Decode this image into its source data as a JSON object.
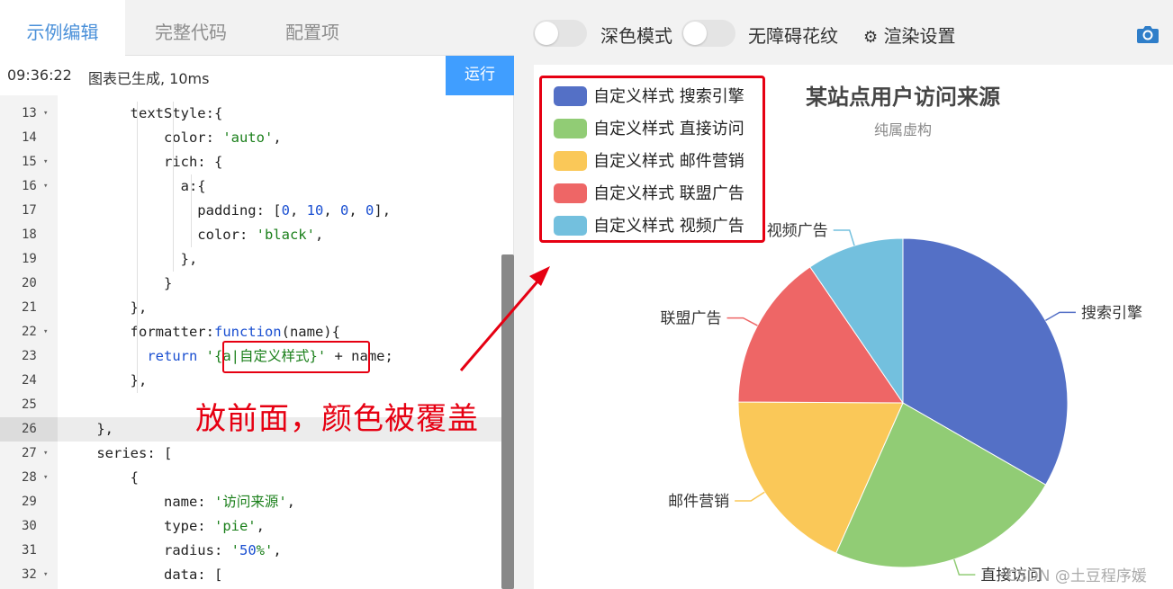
{
  "tabs": [
    "示例编辑",
    "完整代码",
    "配置项"
  ],
  "status": {
    "time": "09:36:22",
    "message": "图表已生成, 10ms"
  },
  "run_label": "运行",
  "code_lines": [
    {
      "n": "13",
      "fold": true,
      "text": "        textStyle:{"
    },
    {
      "n": "14",
      "fold": false,
      "text": "            color: 'auto',"
    },
    {
      "n": "15",
      "fold": true,
      "text": "            rich: {"
    },
    {
      "n": "16",
      "fold": true,
      "text": "              a:{"
    },
    {
      "n": "17",
      "fold": false,
      "text": "                padding: [0, 10, 0, 0],"
    },
    {
      "n": "18",
      "fold": false,
      "text": "                color: 'black',"
    },
    {
      "n": "19",
      "fold": false,
      "text": "              },"
    },
    {
      "n": "20",
      "fold": false,
      "text": "            }"
    },
    {
      "n": "21",
      "fold": false,
      "text": "        },"
    },
    {
      "n": "22",
      "fold": true,
      "text": "        formatter:function(name){"
    },
    {
      "n": "23",
      "fold": false,
      "text": "          return '{a|自定义样式}' + name;"
    },
    {
      "n": "24",
      "fold": false,
      "text": "        },"
    },
    {
      "n": "25",
      "fold": false,
      "text": ""
    },
    {
      "n": "26",
      "fold": false,
      "text": "    },"
    },
    {
      "n": "27",
      "fold": true,
      "text": "    series: ["
    },
    {
      "n": "28",
      "fold": true,
      "text": "        {"
    },
    {
      "n": "29",
      "fold": false,
      "text": "            name: '访问来源',"
    },
    {
      "n": "30",
      "fold": false,
      "text": "            type: 'pie',"
    },
    {
      "n": "31",
      "fold": false,
      "text": "            radius: '50%',"
    },
    {
      "n": "32",
      "fold": true,
      "text": "            data: ["
    }
  ],
  "highlight_line": "26",
  "annotation_text": "放前面，颜色被覆盖",
  "toggles": [
    {
      "label": "深色模式"
    },
    {
      "label": "无障碍花纹"
    }
  ],
  "render_settings_label": "渲染设置",
  "colors": {
    "accent": "#409eff",
    "annotation": "#e60012",
    "tab_active": "#4a90d9"
  },
  "chart_data": {
    "type": "pie",
    "title": "某站点用户访问来源",
    "subtitle": "纯属虚构",
    "legend_prefix": "自定义样式",
    "legend_position": "top-left",
    "series": [
      {
        "name": "访问来源",
        "slices": [
          {
            "name": "搜索引擎",
            "value": 1048,
            "color": "#5470c6"
          },
          {
            "name": "直接访问",
            "value": 735,
            "color": "#91cc75"
          },
          {
            "name": "邮件营销",
            "value": 580,
            "color": "#fac858"
          },
          {
            "name": "联盟广告",
            "value": 484,
            "color": "#ee6666"
          },
          {
            "name": "视频广告",
            "value": 300,
            "color": "#73c0de"
          }
        ]
      }
    ]
  },
  "watermark": "CSDN @土豆程序媛"
}
